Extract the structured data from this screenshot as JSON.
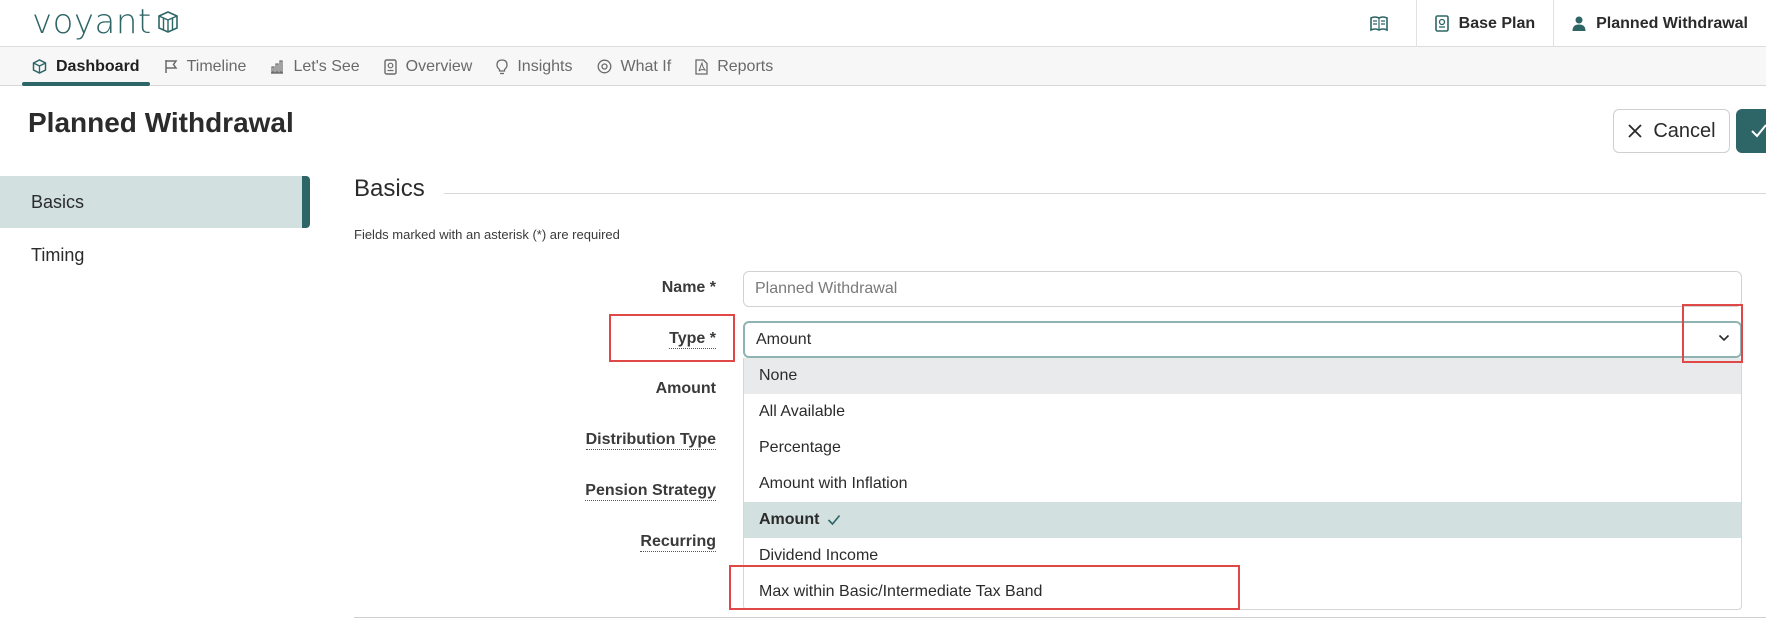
{
  "app": {
    "logo_text": "voyant",
    "colors": {
      "brand": "#2e6566",
      "brand_light": "#d2e0e0",
      "highlight": "#e04848"
    }
  },
  "header": {
    "book_icon": "book-icon",
    "plan_label": "Base Plan",
    "user_label": "Planned Withdrawal"
  },
  "nav": {
    "tabs": [
      {
        "label": "Dashboard",
        "icon": "dashboard-icon",
        "active": true
      },
      {
        "label": "Timeline",
        "icon": "flag-icon"
      },
      {
        "label": "Let's See",
        "icon": "bar-chart-icon"
      },
      {
        "label": "Overview",
        "icon": "document-icon"
      },
      {
        "label": "Insights",
        "icon": "lightbulb-icon"
      },
      {
        "label": "What If",
        "icon": "at-icon"
      },
      {
        "label": "Reports",
        "icon": "pdf-icon"
      }
    ]
  },
  "page": {
    "title": "Planned Withdrawal",
    "cancel_label": "Cancel"
  },
  "sidemenu": {
    "items": [
      {
        "label": "Basics",
        "active": true
      },
      {
        "label": "Timing"
      }
    ]
  },
  "form": {
    "section_title": "Basics",
    "required_note": "Fields marked with an asterisk (*) are required",
    "labels": {
      "name": "Name *",
      "type": "Type *",
      "amount": "Amount",
      "distribution_type": "Distribution Type",
      "pension_strategy": "Pension Strategy",
      "recurring": "Recurring"
    },
    "name_value": "Planned Withdrawal",
    "type_value": "Amount",
    "type_options": [
      "None",
      "All Available",
      "Percentage",
      "Amount with Inflation",
      "Amount",
      "Dividend Income",
      "Max within Basic/Intermediate Tax Band"
    ]
  }
}
